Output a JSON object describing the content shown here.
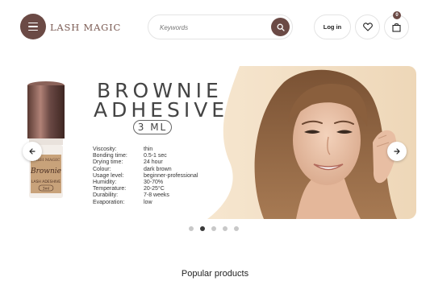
{
  "header": {
    "logo_text": "LASH MAGIC",
    "search": {
      "placeholder": "Keywords"
    },
    "login_label": "Log in",
    "cart_count": "0"
  },
  "hero": {
    "title_line1": "BROWNIE",
    "title_line2": "ADHESIVE",
    "volume": "3 ML",
    "bottle_label_brand": "LASH MAGIC",
    "bottle_label_name": "Brownie",
    "bottle_label_type": "LASH ADESHIVE",
    "bottle_label_volume": "3ml",
    "specs": [
      {
        "key": "Viscosity:",
        "value": "thin"
      },
      {
        "key": "Bonding time:",
        "value": "0.5-1 sec"
      },
      {
        "key": "Drying time:",
        "value": "24 hour"
      },
      {
        "key": "Colour:",
        "value": "dark brown"
      },
      {
        "key": "Usage level:",
        "value": "beginner-professional"
      },
      {
        "key": "Humidity:",
        "value": "30-70%"
      },
      {
        "key": "Temperature:",
        "value": "20-25°C"
      },
      {
        "key": "Durability:",
        "value": "7-8 weeks"
      },
      {
        "key": "Evaporation:",
        "value": "low"
      }
    ]
  },
  "carousel": {
    "slide_count": 5,
    "active_index": 1
  },
  "sections": {
    "popular_title": "Popular products"
  },
  "colors": {
    "brand": "#6b4a45",
    "hero_bg": "#f0dcc0"
  },
  "icons": [
    "menu-icon",
    "search-icon",
    "heart-icon",
    "cart-icon",
    "chevron-left-icon",
    "chevron-right-icon"
  ]
}
